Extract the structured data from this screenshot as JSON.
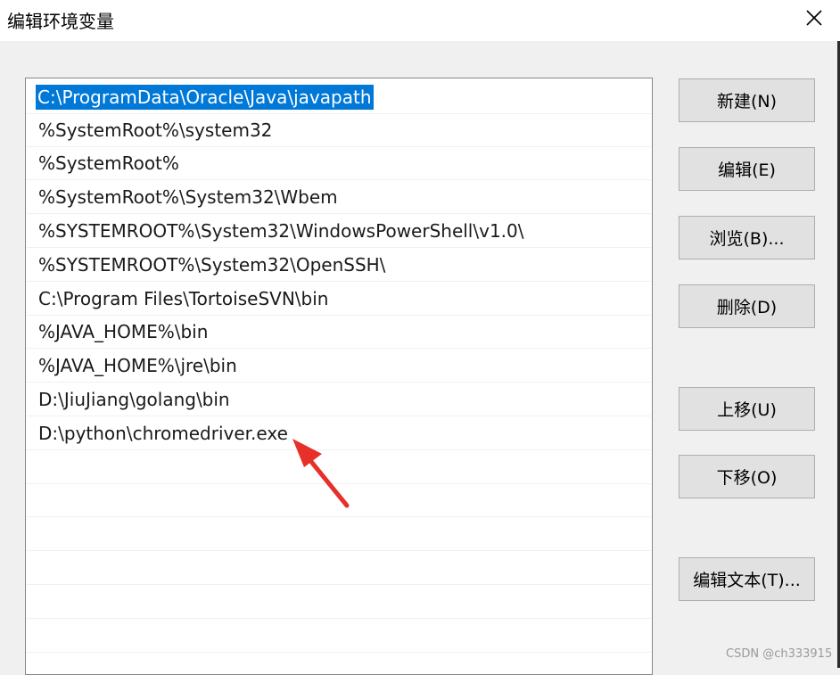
{
  "window": {
    "title": "编辑环境变量"
  },
  "paths": [
    "C:\\ProgramData\\Oracle\\Java\\javapath",
    "%SystemRoot%\\system32",
    "%SystemRoot%",
    "%SystemRoot%\\System32\\Wbem",
    "%SYSTEMROOT%\\System32\\WindowsPowerShell\\v1.0\\",
    "%SYSTEMROOT%\\System32\\OpenSSH\\",
    "C:\\Program Files\\TortoiseSVN\\bin",
    "%JAVA_HOME%\\bin",
    "%JAVA_HOME%\\jre\\bin",
    "D:\\JiuJiang\\golang\\bin",
    "D:\\python\\chromedriver.exe"
  ],
  "selected_index": 0,
  "buttons": {
    "new": "新建(N)",
    "edit": "编辑(E)",
    "browse": "浏览(B)...",
    "delete": "删除(D)",
    "move_up": "上移(U)",
    "move_down": "下移(O)",
    "edit_text": "编辑文本(T)..."
  },
  "watermark": "CSDN @ch333915",
  "colors": {
    "selection": "#0078d7",
    "arrow": "#e8302a"
  }
}
